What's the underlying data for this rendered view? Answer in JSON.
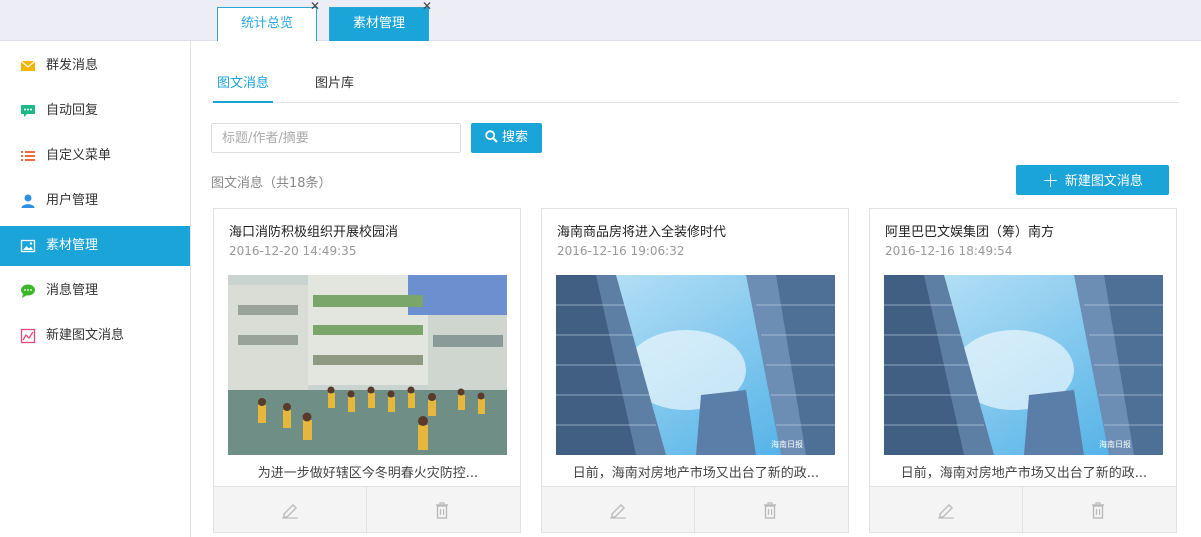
{
  "top_tabs": [
    {
      "label": "统计总览",
      "active": false
    },
    {
      "label": "素材管理",
      "active": true
    }
  ],
  "sidebar": {
    "items": [
      {
        "label": "群发消息",
        "icon": "envelope-icon",
        "color": "#f5b400"
      },
      {
        "label": "自动回复",
        "icon": "chat-bubble-icon",
        "color": "#1bb98a"
      },
      {
        "label": "自定义菜单",
        "icon": "list-icon",
        "color": "#f06a3c"
      },
      {
        "label": "用户管理",
        "icon": "user-icon",
        "color": "#2d8fe0"
      },
      {
        "label": "素材管理",
        "icon": "image-icon",
        "color": "#ffffff",
        "active": true
      },
      {
        "label": "消息管理",
        "icon": "message-icon",
        "color": "#3cb72a"
      },
      {
        "label": "新建图文消息",
        "icon": "chart-icon",
        "color": "#e24a7a"
      }
    ]
  },
  "sub_tabs": [
    {
      "label": "图文消息",
      "active": true
    },
    {
      "label": "图片库",
      "active": false
    }
  ],
  "search": {
    "placeholder": "标题/作者/摘要",
    "button_label": "搜索"
  },
  "count_label": "图文消息（共18条）",
  "new_button_label": "新建图文消息",
  "cards": [
    {
      "title": "海口消防积极组织开展校园消",
      "date": "2016-12-20 14:49:35",
      "summary": "为进一步做好辖区今冬明春火灾防控...",
      "image": "schoolyard-photo"
    },
    {
      "title": "海南商品房将进入全装修时代",
      "date": "2016-12-16 19:06:32",
      "summary": "日前，海南对房地产市场又出台了新的政...",
      "image": "skyscrapers-photo"
    },
    {
      "title": "阿里巴巴文娱集团（筹）南方",
      "date": "2016-12-16 18:49:54",
      "summary": "日前，海南对房地产市场又出台了新的政...",
      "image": "skyscrapers-photo"
    }
  ],
  "colors": {
    "accent": "#1ba4d8",
    "sidebar_active_bg": "#1ba4d8",
    "topbar_bg": "#ecedf5"
  }
}
